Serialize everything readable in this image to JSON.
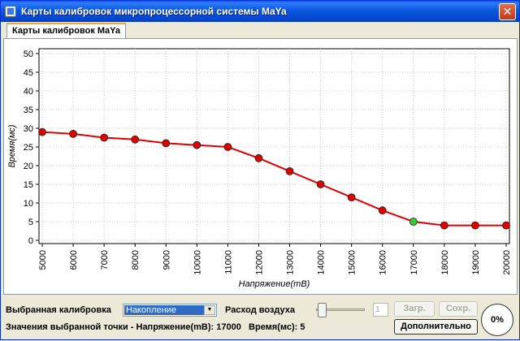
{
  "window": {
    "title": "Карты калибровок микропроцессорной системы MaYa",
    "close_icon": "close-icon"
  },
  "tabs": [
    {
      "label": "Карты калибровок MaYa",
      "active": true
    }
  ],
  "chart_data": {
    "type": "line",
    "x": [
      5000,
      6000,
      7000,
      8000,
      9000,
      10000,
      11000,
      12000,
      13000,
      14000,
      15000,
      16000,
      17000,
      18000,
      19000,
      20000
    ],
    "series": [
      {
        "values": [
          29,
          28.5,
          27.5,
          27,
          26,
          25.5,
          25,
          22,
          18.5,
          15,
          11.5,
          8,
          5,
          4,
          4,
          4
        ],
        "color": "#e00000"
      }
    ],
    "selected_point": {
      "x": 17000,
      "y": 5,
      "color": "#33cc33"
    },
    "xlabel": "Напряжение(mB)",
    "ylabel": "Время(мс)",
    "xlim": [
      5000,
      20000
    ],
    "ylim": [
      0,
      50
    ],
    "yticks": [
      0,
      5,
      10,
      15,
      20,
      25,
      30,
      35,
      40,
      45,
      50
    ],
    "xticks": [
      "5000",
      "6000",
      "7000",
      "8000",
      "9000",
      "10000",
      "11000",
      "12000",
      "13000",
      "14000",
      "15000",
      "16000",
      "17000",
      "18000",
      "19000",
      "20000"
    ],
    "grid": true
  },
  "controls": {
    "calibration_label": "Выбранная калибровка",
    "calibration_value": "Накопление",
    "airflow_label": "Расход воздуха",
    "airflow_value": "1",
    "load_label": "Загр.",
    "save_label": "Сохр.",
    "extra_label": "Дополнительно",
    "progress": "0%",
    "status_prefix": "Значения выбранной точки - Напряжение(mB): ",
    "status_voltage": "17000",
    "status_time_label": "Время(мс): ",
    "status_time": "5"
  }
}
